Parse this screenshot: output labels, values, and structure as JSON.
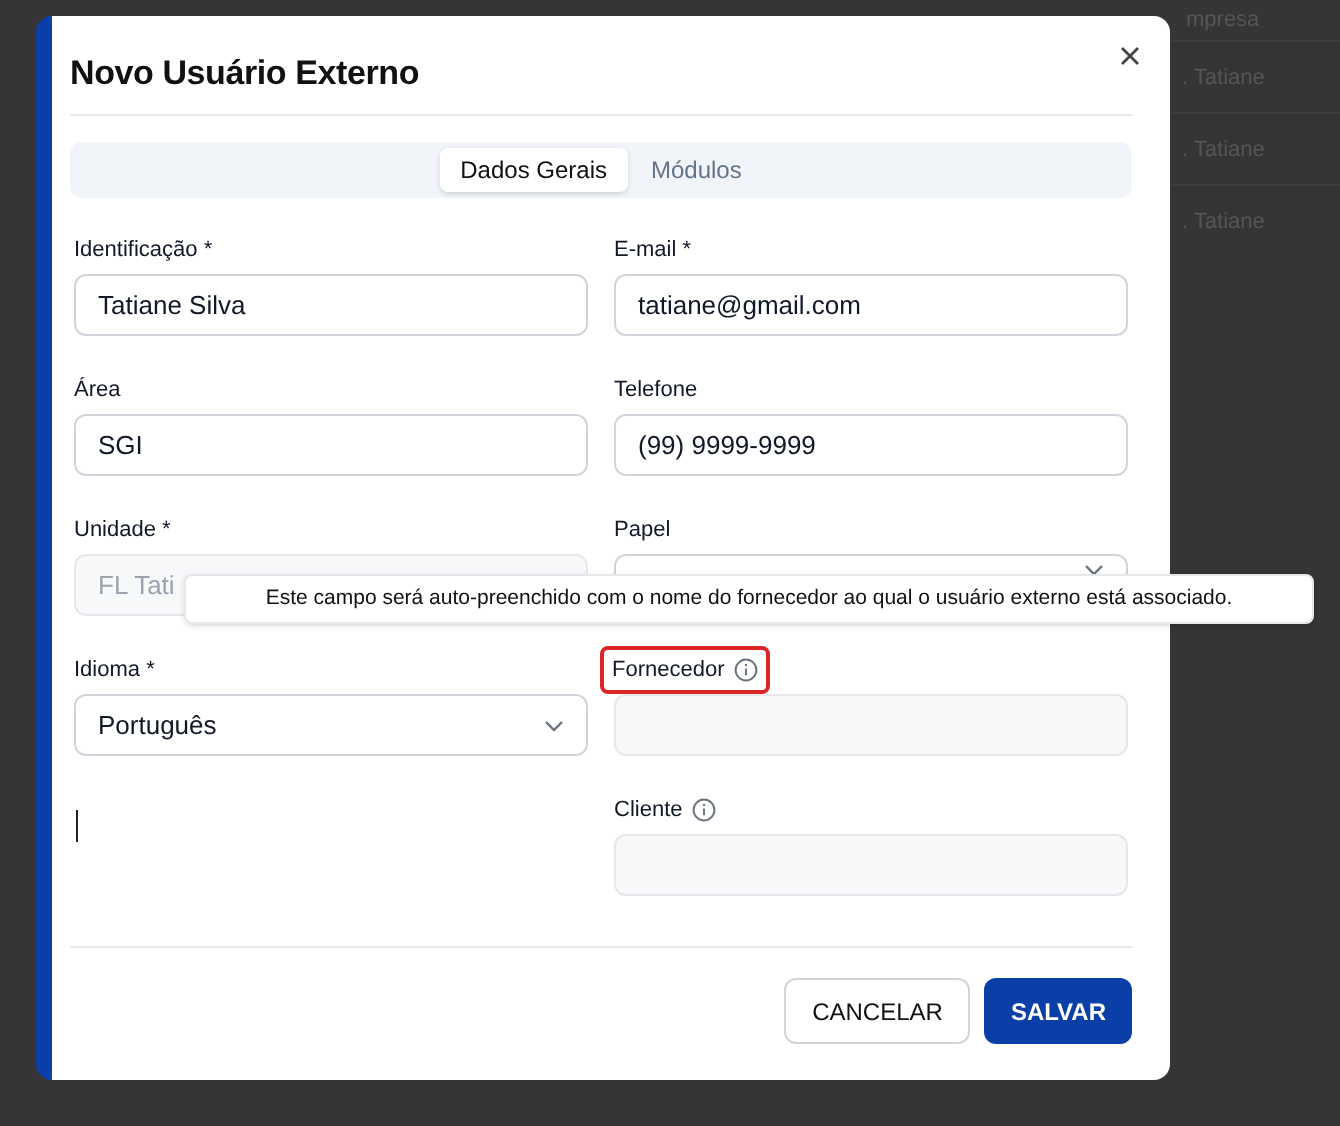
{
  "background_table": {
    "header": "mpresa",
    "cells": [
      ". Tatiane",
      ". Tatiane",
      ". Tatiane"
    ]
  },
  "dialog": {
    "title": "Novo Usuário Externo",
    "tabs": [
      {
        "label": "Dados Gerais",
        "selected": true
      },
      {
        "label": "Módulos",
        "selected": false
      }
    ],
    "fields": [
      {
        "kind": "text",
        "label": "Identificação *",
        "value": "Tatiane Silva",
        "disabled": false
      },
      {
        "kind": "text",
        "label": "E-mail *",
        "value": "tatiane@gmail.com",
        "disabled": false
      },
      {
        "kind": "text",
        "label": "Área",
        "value": "SGI",
        "disabled": false
      },
      {
        "kind": "text",
        "label": "Telefone",
        "value": "(99) 9999-9999",
        "disabled": false
      },
      {
        "kind": "text",
        "label": "Unidade *",
        "value": "FL Tati",
        "disabled": true
      },
      {
        "kind": "select",
        "label": "Papel",
        "disabled": false
      },
      {
        "kind": "select",
        "label": "Idioma *",
        "value": "Português",
        "disabled": false
      },
      {
        "kind": "info",
        "label": "Fornecedor",
        "disabled": true,
        "highlighted": true
      },
      {
        "kind": "cursor"
      },
      {
        "kind": "info",
        "label": "Cliente",
        "disabled": true,
        "highlighted": false
      }
    ],
    "tooltip": "Este campo será auto-preenchido com o nome do fornecedor ao qual o usuário externo está associado.",
    "buttons": [
      {
        "label": "CANCELAR",
        "kind": "secondary"
      },
      {
        "label": "SALVAR",
        "kind": "primary"
      }
    ]
  }
}
